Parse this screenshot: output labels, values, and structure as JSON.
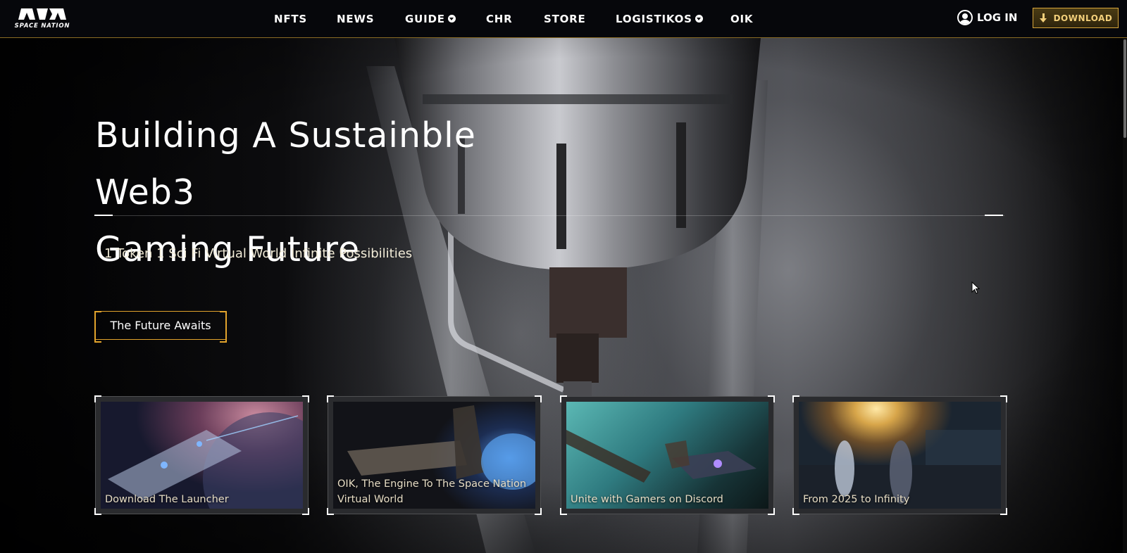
{
  "brand": {
    "logo_text": "SPACE NATION"
  },
  "nav": {
    "items": [
      {
        "label": "NFTS",
        "has_dropdown": false
      },
      {
        "label": "NEWS",
        "has_dropdown": false
      },
      {
        "label": "GUIDE",
        "has_dropdown": true
      },
      {
        "label": "CHR",
        "has_dropdown": false
      },
      {
        "label": "STORE",
        "has_dropdown": false
      },
      {
        "label": "LOGISTIKOS",
        "has_dropdown": true
      },
      {
        "label": "OIK",
        "has_dropdown": false
      }
    ],
    "login_label": "LOG IN",
    "download_label": "DOWNLOAD",
    "icons": {
      "login": "user-circle-icon",
      "download": "download-arrow-icon",
      "dropdown": "chevron-down-icon"
    }
  },
  "hero": {
    "title_line1": "Building A Sustainble Web3",
    "title_line2": "Gaming Future",
    "tagline": "1 Token 1 Sci Fi Virtual World Infinite Possibilities",
    "cta_label": "The Future Awaits"
  },
  "cards": [
    {
      "caption": "Download The Launcher"
    },
    {
      "caption": "OIK, The Engine To The Space Nation Virtual World"
    },
    {
      "caption": "Unite with Gamers on Discord"
    },
    {
      "caption": "From 2025 to Infinity"
    }
  ],
  "colors": {
    "accent_gold": "#e2a32c",
    "nav_bg": "#06070b",
    "download_text": "#f2cf7a",
    "caption_text": "#e6dcc4"
  }
}
